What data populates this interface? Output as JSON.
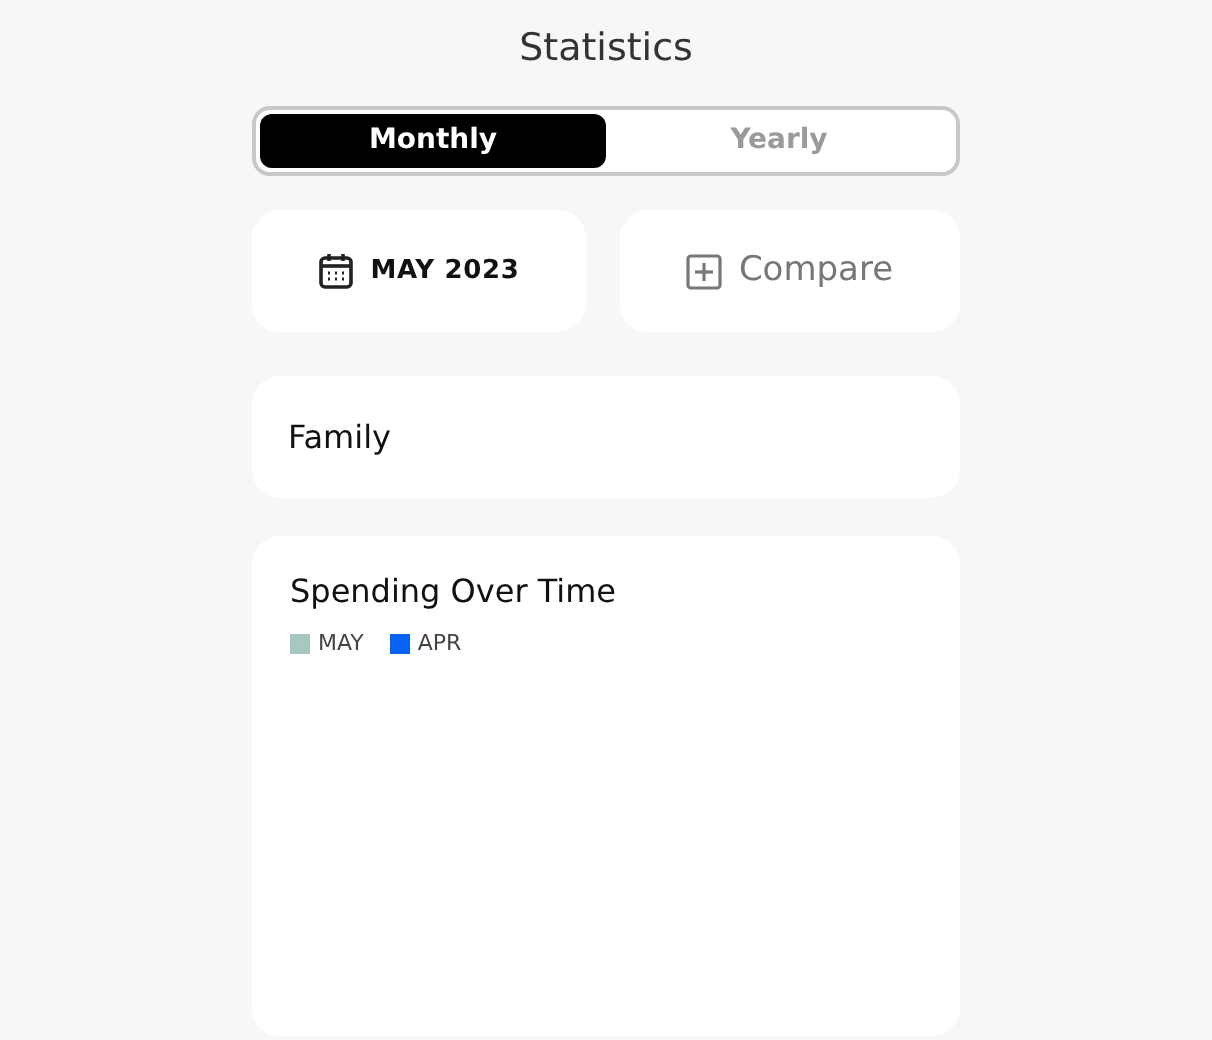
{
  "title": "Statistics",
  "tabs": [
    {
      "label": "Monthly",
      "selected": true
    },
    {
      "label": "Yearly",
      "selected": false
    }
  ],
  "period_button": {
    "label": "MAY 2023"
  },
  "compare_button": {
    "label": "Compare"
  },
  "group_card": {
    "label": "Family"
  },
  "spending_card": {
    "title": "Spending Over Time",
    "legend": [
      {
        "label": "MAY",
        "color": "#a6c8c0"
      },
      {
        "label": "APR",
        "color": "#0a62f5"
      }
    ]
  }
}
